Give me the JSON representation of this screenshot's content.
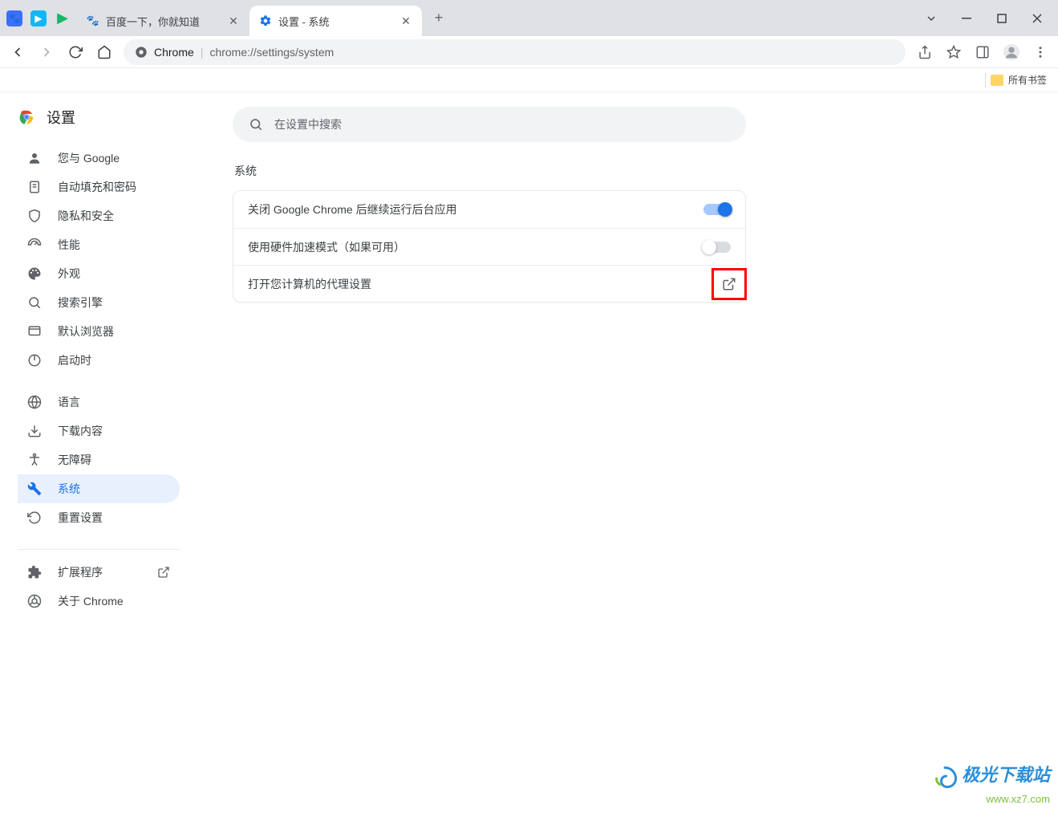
{
  "browser": {
    "tabs": [
      {
        "title": "百度一下，你就知道"
      },
      {
        "title": "设置 - 系统"
      }
    ],
    "url_origin": "Chrome",
    "url_path": "chrome://settings/system",
    "bookmark_all": "所有书签"
  },
  "sidebar": {
    "title": "设置",
    "items": {
      "you_google": "您与 Google",
      "autofill": "自动填充和密码",
      "privacy": "隐私和安全",
      "performance": "性能",
      "appearance": "外观",
      "search": "搜索引擎",
      "default_browser": "默认浏览器",
      "on_startup": "启动时",
      "languages": "语言",
      "downloads": "下载内容",
      "accessibility": "无障碍",
      "system": "系统",
      "reset": "重置设置",
      "extensions": "扩展程序",
      "about": "关于 Chrome"
    }
  },
  "main": {
    "search_placeholder": "在设置中搜索",
    "section_title": "系统",
    "rows": {
      "bg": "关闭 Google Chrome 后继续运行后台应用",
      "hw": "使用硬件加速模式（如果可用）",
      "proxy": "打开您计算机的代理设置"
    }
  },
  "watermark": {
    "line1": "极光下载站",
    "line2": "www.xz7.com"
  }
}
